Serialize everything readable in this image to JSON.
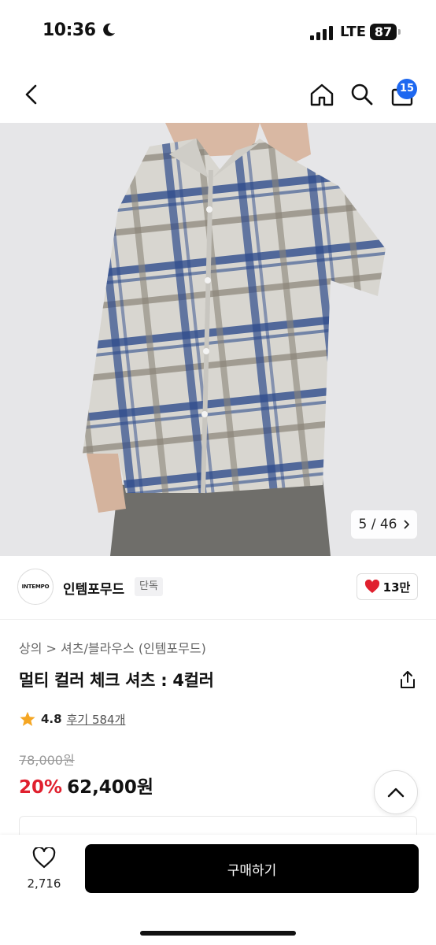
{
  "status_bar": {
    "time": "10:36",
    "network": "LTE",
    "battery": "87"
  },
  "header": {
    "cart_count": "15"
  },
  "gallery": {
    "current": "5",
    "total": "46",
    "counter_text": "5 / 46"
  },
  "brand": {
    "logo_text": "INTEMPO",
    "name": "인템포무드",
    "tag": "단독",
    "likes": "13만"
  },
  "breadcrumb": {
    "text": "상의 > 셔츠/블라우스 (인템포무드)"
  },
  "product": {
    "title": "멀티 컬러 체크 셔츠 : 4컬러",
    "rating": "4.8",
    "reviews": "후기 584개",
    "original_price": "78,000원",
    "discount": "20%",
    "sale_price": "62,400원"
  },
  "bottom_bar": {
    "wish_count": "2,716",
    "buy_label": "구매하기"
  },
  "colors": {
    "accent": "#1e68f0",
    "discount": "#e0202e",
    "heart": "#e0202e",
    "star": "#f5a623"
  }
}
